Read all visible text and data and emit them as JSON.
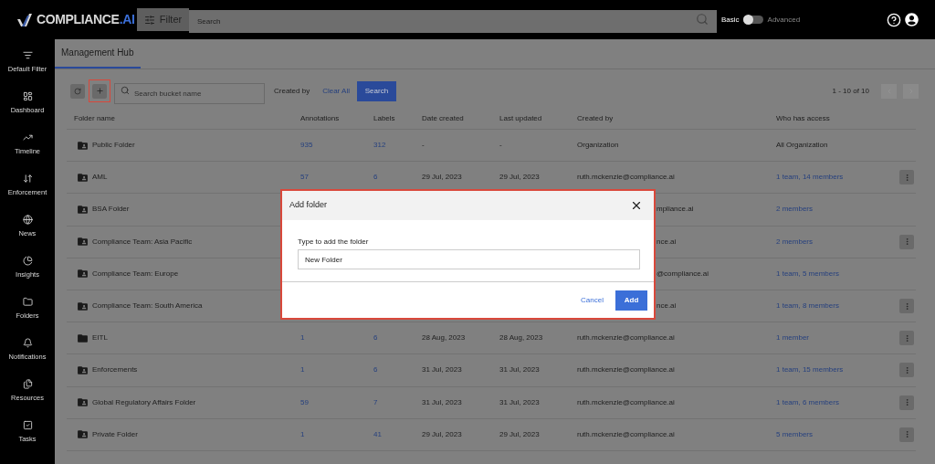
{
  "brand": {
    "name": "COMPLIANCE",
    "suffix": ".AI"
  },
  "topbar": {
    "filter_label": "Filter",
    "search_placeholder": "Search",
    "mode_left": "Basic",
    "mode_right": "Advanced",
    "advanced_on": false
  },
  "sidebar": {
    "items": [
      {
        "label": "Default Filter"
      },
      {
        "label": "Dashboard"
      },
      {
        "label": "Timeline"
      },
      {
        "label": "Enforcement"
      },
      {
        "label": "News"
      },
      {
        "label": "Insights"
      },
      {
        "label": "Folders"
      },
      {
        "label": "Notifications"
      },
      {
        "label": "Resources"
      },
      {
        "label": "Tasks"
      }
    ]
  },
  "tabs": [
    {
      "label": "Management Hub",
      "selected": true
    }
  ],
  "toolbar": {
    "search_placeholder": "Search bucket name",
    "created_by_label": "Created by",
    "clear_label": "Clear All",
    "search_button": "Search",
    "add_highlighted": true
  },
  "pagination": {
    "range": "1 - 10 of 10"
  },
  "table": {
    "columns": [
      "Folder name",
      "Annotations",
      "Labels",
      "Date created",
      "Last updated",
      "Created by",
      "Who has access"
    ],
    "rows": [
      {
        "kind": "shared",
        "name": "Public Folder",
        "covered": false,
        "annotations": "935",
        "labels": "312",
        "date_created": "-",
        "last_updated": "-",
        "created_by": "Organization",
        "access": "All Organization",
        "access_link": false,
        "menu": false
      },
      {
        "kind": "shared",
        "name": "AML",
        "covered": false,
        "annotations": "57",
        "labels": "6",
        "date_created": "29 Jul, 2023",
        "last_updated": "29 Jul, 2023",
        "created_by": "ruth.mckenzie@compliance.ai",
        "access": "1 team, 14 members",
        "access_link": true,
        "menu": true
      },
      {
        "kind": "shared",
        "name": "BSA Folder",
        "covered": true,
        "created_by": "mpliance.ai",
        "access": "2 members",
        "access_link": true,
        "menu": false
      },
      {
        "kind": "shared",
        "name": "Compliance Team: Asia Pacific",
        "covered": true,
        "created_by": "nce.ai",
        "access": "2 members",
        "access_link": true,
        "menu": true
      },
      {
        "kind": "shared",
        "name": "Compliance Team: Europe",
        "covered": true,
        "created_by": "@compliance.ai",
        "access": "1 team, 5 members",
        "access_link": true,
        "menu": false
      },
      {
        "kind": "shared",
        "name": "Compliance Team: South America",
        "covered": true,
        "created_by": "nce.ai",
        "access": "1 team, 8 members",
        "access_link": true,
        "menu": true
      },
      {
        "kind": "plain",
        "name": "EITL",
        "covered": false,
        "annotations": "1",
        "labels": "6",
        "date_created": "28 Aug, 2023",
        "last_updated": "28 Aug, 2023",
        "created_by": "ruth.mckenzie@compliance.ai",
        "access": "1 member",
        "access_link": true,
        "menu": true
      },
      {
        "kind": "shared",
        "name": "Enforcements",
        "covered": false,
        "annotations": "1",
        "labels": "6",
        "date_created": "31 Jul, 2023",
        "last_updated": "31 Jul, 2023",
        "created_by": "ruth.mckenzie@compliance.ai",
        "access": "1 team, 15 members",
        "access_link": true,
        "menu": true
      },
      {
        "kind": "shared",
        "name": "Global Regulatory Affairs Folder",
        "covered": false,
        "annotations": "59",
        "labels": "7",
        "date_created": "31 Jul, 2023",
        "last_updated": "31 Jul, 2023",
        "created_by": "ruth.mckenzie@compliance.ai",
        "access": "1 team, 6 members",
        "access_link": true,
        "menu": true
      },
      {
        "kind": "shared",
        "name": "Private Folder",
        "covered": false,
        "annotations": "1",
        "labels": "41",
        "date_created": "29 Jul, 2023",
        "last_updated": "29 Jul, 2023",
        "created_by": "ruth.mckenzie@compliance.ai",
        "access": "5 members",
        "access_link": true,
        "menu": true
      }
    ]
  },
  "dialog": {
    "title": "Add folder",
    "field_label": "Type to add the folder",
    "field_value": "New Folder",
    "cancel": "Cancel",
    "confirm": "Add",
    "highlighted": true
  }
}
